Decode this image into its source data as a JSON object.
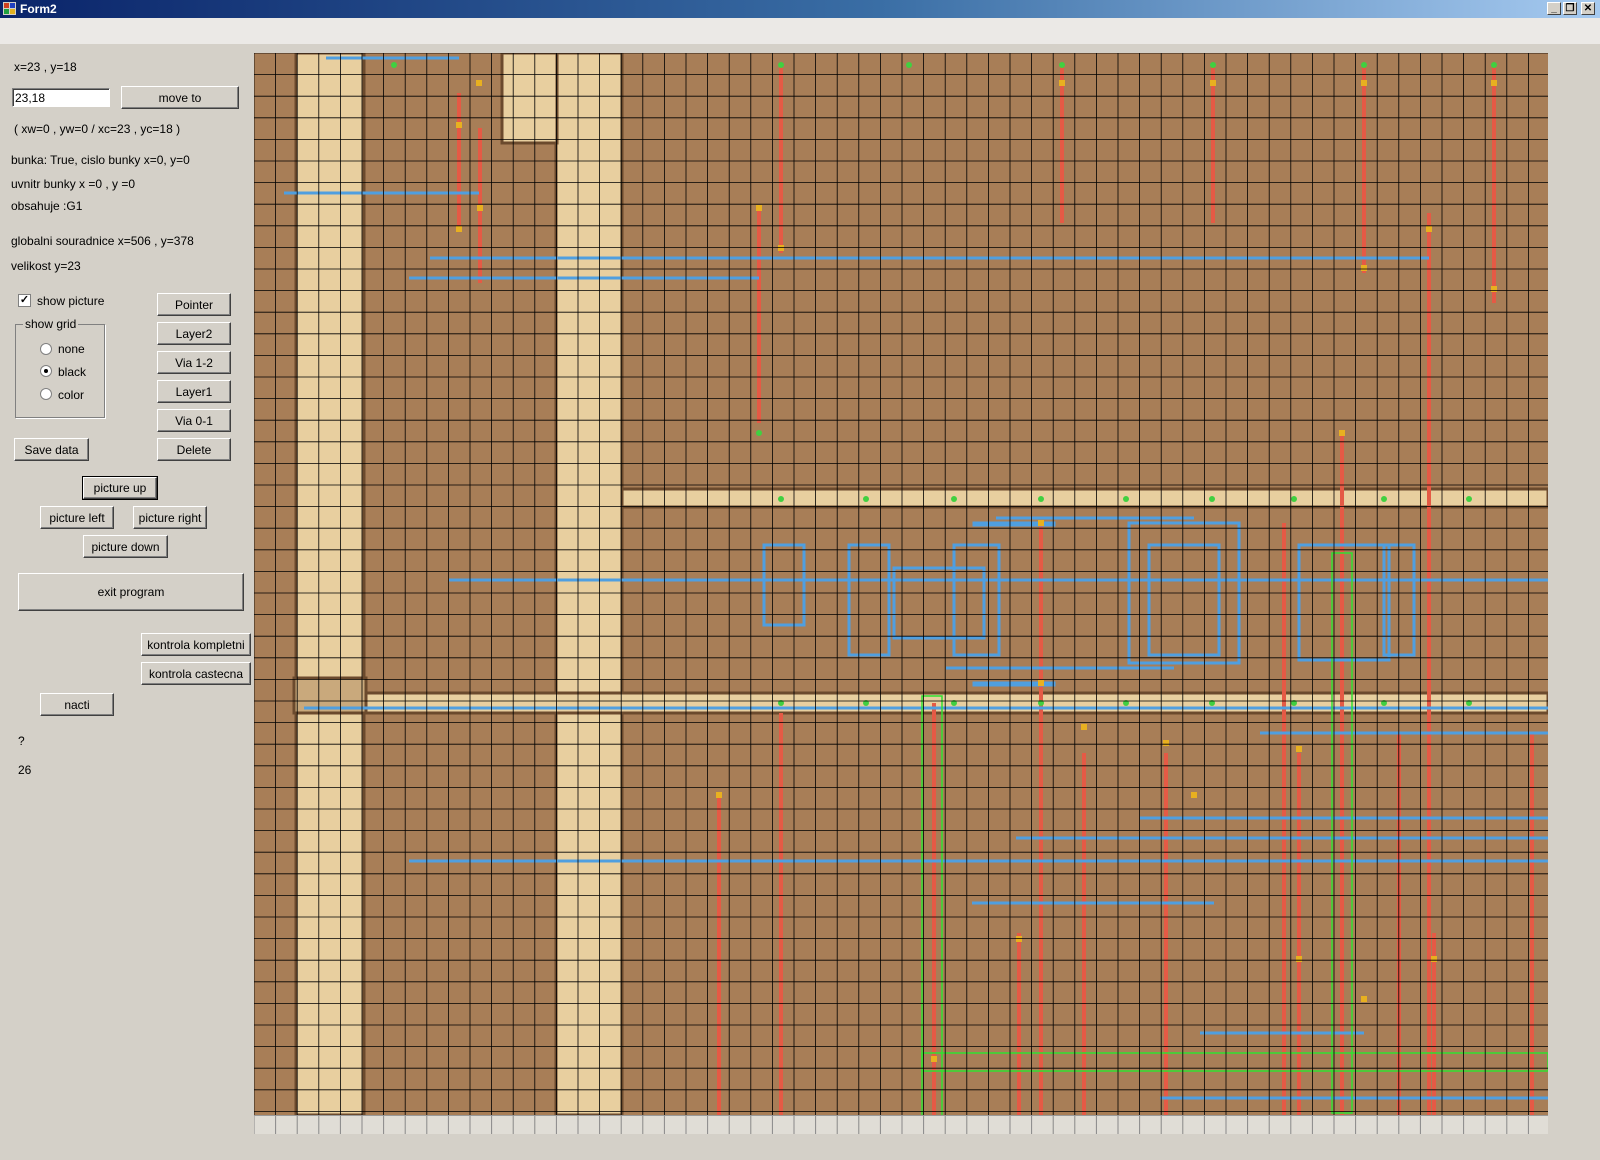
{
  "window": {
    "title": "Form2"
  },
  "status": {
    "cursor": "x=23 ,  y=18",
    "coords_detail": "( xw=0 , yw=0 / xc=23 , yc=18 )",
    "bunka": "bunka: True, cislo bunky x=0, y=0",
    "uvnitr": "uvnitr bunky x =0 , y =0",
    "obsahuje": "obsahuje :G1",
    "globalni": "globalni souradnice x=506 , y=378",
    "velikost": "velikost y=23",
    "question": "?",
    "count": "26"
  },
  "moveto": {
    "input_value": "23,18",
    "button": "move to"
  },
  "options": {
    "show_picture_label": "show picture",
    "show_picture_checked": true,
    "grid_group_label": "show grid",
    "grid_options": [
      "none",
      "black",
      "color"
    ],
    "grid_selected": "black"
  },
  "tools": {
    "pointer": "Pointer",
    "layer2": "Layer2",
    "via12": "Via 1-2",
    "layer1": "Layer1",
    "via01": "Via 0-1",
    "delete": "Delete"
  },
  "buttons": {
    "save": "Save data",
    "picture_up": "picture up",
    "picture_left": "picture left",
    "picture_right": "picture right",
    "picture_down": "picture down",
    "exit": "exit program",
    "kontrola_kompletni": "kontrola kompletni",
    "kontrola_castecna": "kontrola castecna",
    "nacti": "nacti"
  },
  "colors": {
    "die_background": "#a87e57",
    "metal_light": "#e8cf9f",
    "grid_line": "#000000",
    "layer2_wire": "#4f9fe0",
    "layer1_wire": "#e55a45",
    "via": "#e8b020",
    "contact": "#40d040",
    "selection": "#30e030"
  }
}
